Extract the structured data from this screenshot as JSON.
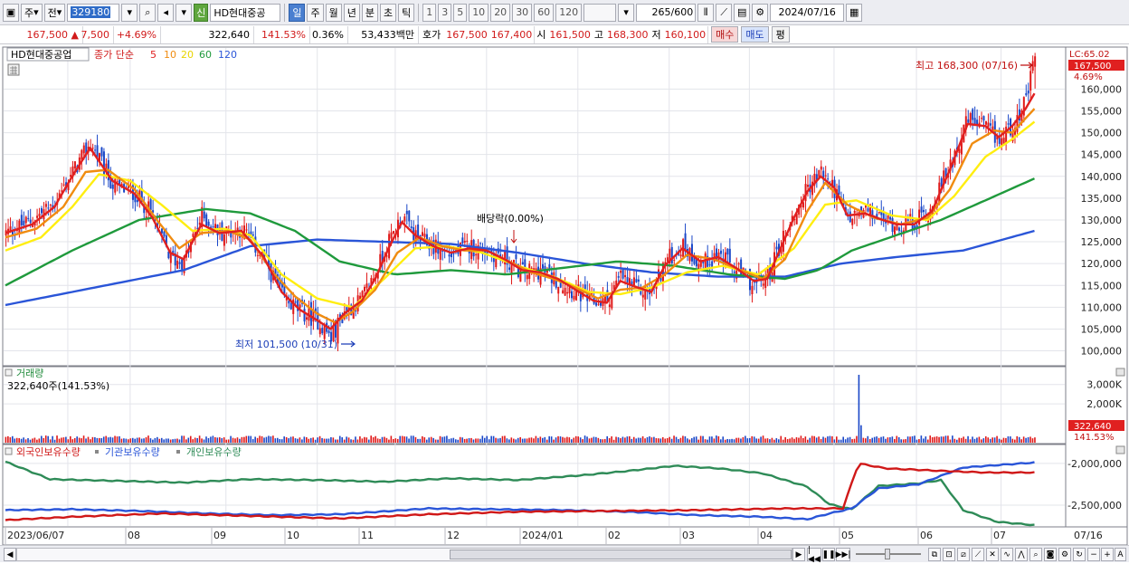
{
  "toolbar": {
    "mode_label": "주",
    "prev_label": "전",
    "code": "329180",
    "stock_name": "HD현대중공",
    "sin_badge": "신",
    "periods": [
      "일",
      "주",
      "월",
      "년",
      "분",
      "초",
      "틱"
    ],
    "active_period": "일",
    "intervals": [
      "1",
      "3",
      "5",
      "10",
      "20",
      "30",
      "60",
      "120"
    ],
    "count_value": "265",
    "count_total": "/600",
    "date": "2024/07/16"
  },
  "quote": {
    "price": "167,500",
    "change_arrow": "▲",
    "change": "7,500",
    "change_pct": "+4.69%",
    "volume": "322,640",
    "volume_ratio": "141.53%",
    "turnover": "0.36%",
    "amount": "53,433백만",
    "bid_label": "호가",
    "ask": "167,500",
    "bid": "167,400",
    "open_label": "시",
    "open": "161,500",
    "high_label": "고",
    "high": "168,300",
    "low_label": "저",
    "low": "160,100",
    "buy_label": "매수",
    "sell_label": "매도",
    "eval_label": "평"
  },
  "price_panel": {
    "stock_tag": "HD현대중공업",
    "ma_title": "종가 단순",
    "ma_periods": [
      "5",
      "10",
      "20",
      "60",
      "120"
    ],
    "ma_colors": [
      "#e02020",
      "#f08c10",
      "#ffee10",
      "#1f9a3c",
      "#2a55d8"
    ],
    "lc_label": "LC:65.02",
    "last_price_tag": "167,500",
    "last_pct_tag": "4.69%",
    "y_ticks": [
      "160,000",
      "155,000",
      "150,000",
      "145,000",
      "140,000",
      "135,000",
      "130,000",
      "125,000",
      "120,000",
      "115,000",
      "110,000",
      "105,000",
      "100,000"
    ],
    "high_annotation": "최고 168,300 (07/16)",
    "low_annotation": "최저 101,500 (10/31)",
    "dividend_annotation": "배당락(0.00%)"
  },
  "volume_panel": {
    "title": "거래량",
    "value_label": "322,640주(141.53%)",
    "y_ticks": [
      "3,000K",
      "2,000K"
    ],
    "last_tag": "322,640",
    "last_pct_tag": "141.53%"
  },
  "holdings_panel": {
    "series_labels": [
      "외국인보유수량",
      "기관보유수량",
      "개인보유수량"
    ],
    "series_colors": [
      "#d01818",
      "#2a55d8",
      "#2e8b57"
    ],
    "y_ticks": [
      "-2,000,000",
      "-2,500,000"
    ]
  },
  "x_axis": {
    "labels": [
      "2023/06/07",
      "08",
      "09",
      "10",
      "11",
      "12",
      "2024/01",
      "02",
      "03",
      "04",
      "05",
      "06",
      "07"
    ],
    "last_label": "07/16"
  },
  "chart_data": {
    "type": "candlestick",
    "price_range": [
      97000,
      169000
    ],
    "months": [
      "2023/06",
      "2023/07",
      "2023/08",
      "2023/09",
      "2023/10",
      "2023/11",
      "2023/12",
      "2024/01",
      "2024/02",
      "2024/03",
      "2024/04",
      "2024/05",
      "2024/06",
      "2024/07"
    ],
    "close_path": [
      [
        0,
        127000
      ],
      [
        12,
        130000
      ],
      [
        22,
        134000
      ],
      [
        30,
        141000
      ],
      [
        38,
        147500
      ],
      [
        48,
        138000
      ],
      [
        58,
        136000
      ],
      [
        66,
        131000
      ],
      [
        74,
        121000
      ],
      [
        80,
        120500
      ],
      [
        88,
        131000
      ],
      [
        96,
        127000
      ],
      [
        106,
        128000
      ],
      [
        116,
        121000
      ],
      [
        124,
        112500
      ],
      [
        132,
        109000
      ],
      [
        140,
        107000
      ],
      [
        146,
        103000
      ],
      [
        152,
        109000
      ],
      [
        160,
        112000
      ],
      [
        166,
        118000
      ],
      [
        172,
        125000
      ],
      [
        178,
        131000
      ],
      [
        184,
        126000
      ],
      [
        192,
        124000
      ],
      [
        200,
        122000
      ],
      [
        208,
        124000
      ],
      [
        216,
        123000
      ],
      [
        224,
        121000
      ],
      [
        232,
        118000
      ],
      [
        240,
        118500
      ],
      [
        248,
        116000
      ],
      [
        256,
        113500
      ],
      [
        264,
        111000
      ],
      [
        270,
        111500
      ],
      [
        276,
        117000
      ],
      [
        284,
        114000
      ],
      [
        290,
        113500
      ],
      [
        296,
        120500
      ],
      [
        304,
        124000
      ],
      [
        312,
        120000
      ],
      [
        320,
        122000
      ],
      [
        328,
        118500
      ],
      [
        336,
        115000
      ],
      [
        342,
        117000
      ],
      [
        348,
        125000
      ],
      [
        354,
        131000
      ],
      [
        360,
        137500
      ],
      [
        366,
        141000
      ],
      [
        372,
        137000
      ],
      [
        378,
        130000
      ],
      [
        386,
        132000
      ],
      [
        394,
        130000
      ],
      [
        400,
        129000
      ],
      [
        408,
        129500
      ],
      [
        416,
        133000
      ],
      [
        424,
        143000
      ],
      [
        432,
        153000
      ],
      [
        440,
        151000
      ],
      [
        446,
        148000
      ],
      [
        452,
        152000
      ],
      [
        458,
        157000
      ],
      [
        462,
        167500
      ]
    ],
    "ma5": [
      [
        0,
        127000
      ],
      [
        12,
        129000
      ],
      [
        22,
        133000
      ],
      [
        30,
        140000
      ],
      [
        38,
        146500
      ],
      [
        48,
        139000
      ],
      [
        58,
        136000
      ],
      [
        66,
        130500
      ],
      [
        74,
        122500
      ],
      [
        80,
        121000
      ],
      [
        88,
        129000
      ],
      [
        96,
        127000
      ],
      [
        106,
        127500
      ],
      [
        116,
        121500
      ],
      [
        124,
        113500
      ],
      [
        132,
        109500
      ],
      [
        140,
        107000
      ],
      [
        146,
        105000
      ],
      [
        152,
        108500
      ],
      [
        160,
        111500
      ],
      [
        166,
        116500
      ],
      [
        172,
        123500
      ],
      [
        178,
        129500
      ],
      [
        184,
        126500
      ],
      [
        192,
        124000
      ],
      [
        200,
        122500
      ],
      [
        208,
        123500
      ],
      [
        216,
        123000
      ],
      [
        224,
        121000
      ],
      [
        232,
        118500
      ],
      [
        240,
        118000
      ],
      [
        248,
        116500
      ],
      [
        256,
        114000
      ],
      [
        264,
        111500
      ],
      [
        270,
        111000
      ],
      [
        276,
        116000
      ],
      [
        284,
        114500
      ],
      [
        290,
        113500
      ],
      [
        296,
        119500
      ],
      [
        304,
        123500
      ],
      [
        312,
        120500
      ],
      [
        320,
        121500
      ],
      [
        328,
        119000
      ],
      [
        336,
        116000
      ],
      [
        342,
        116500
      ],
      [
        348,
        123500
      ],
      [
        354,
        130500
      ],
      [
        360,
        136500
      ],
      [
        366,
        140000
      ],
      [
        372,
        137500
      ],
      [
        378,
        131000
      ],
      [
        386,
        131500
      ],
      [
        394,
        130000
      ],
      [
        400,
        129000
      ],
      [
        408,
        129000
      ],
      [
        416,
        132000
      ],
      [
        424,
        141500
      ],
      [
        432,
        152000
      ],
      [
        440,
        151500
      ],
      [
        446,
        149000
      ],
      [
        452,
        151500
      ],
      [
        458,
        155500
      ],
      [
        462,
        159000
      ]
    ],
    "ma10": [
      [
        0,
        126000
      ],
      [
        14,
        128000
      ],
      [
        26,
        133000
      ],
      [
        36,
        141000
      ],
      [
        46,
        141500
      ],
      [
        58,
        137000
      ],
      [
        68,
        130000
      ],
      [
        78,
        123500
      ],
      [
        88,
        127000
      ],
      [
        100,
        127500
      ],
      [
        110,
        125500
      ],
      [
        120,
        118000
      ],
      [
        130,
        112500
      ],
      [
        140,
        108500
      ],
      [
        148,
        106500
      ],
      [
        156,
        109000
      ],
      [
        166,
        114000
      ],
      [
        176,
        122500
      ],
      [
        186,
        126000
      ],
      [
        196,
        124000
      ],
      [
        206,
        123000
      ],
      [
        216,
        123000
      ],
      [
        226,
        120500
      ],
      [
        236,
        118000
      ],
      [
        246,
        116500
      ],
      [
        256,
        114500
      ],
      [
        266,
        112000
      ],
      [
        276,
        114000
      ],
      [
        286,
        114500
      ],
      [
        296,
        117500
      ],
      [
        306,
        122000
      ],
      [
        318,
        121000
      ],
      [
        330,
        118500
      ],
      [
        340,
        116500
      ],
      [
        350,
        121000
      ],
      [
        360,
        132000
      ],
      [
        368,
        138500
      ],
      [
        378,
        133500
      ],
      [
        390,
        130500
      ],
      [
        402,
        129000
      ],
      [
        414,
        130500
      ],
      [
        424,
        137000
      ],
      [
        434,
        147500
      ],
      [
        444,
        150500
      ],
      [
        452,
        150000
      ],
      [
        462,
        155500
      ]
    ],
    "ma20": [
      [
        0,
        123000
      ],
      [
        16,
        126000
      ],
      [
        30,
        133000
      ],
      [
        42,
        140500
      ],
      [
        56,
        139000
      ],
      [
        70,
        133500
      ],
      [
        84,
        127500
      ],
      [
        98,
        128000
      ],
      [
        110,
        126500
      ],
      [
        124,
        117500
      ],
      [
        140,
        112000
      ],
      [
        156,
        110000
      ],
      [
        170,
        116500
      ],
      [
        184,
        123500
      ],
      [
        198,
        124000
      ],
      [
        214,
        122500
      ],
      [
        230,
        119500
      ],
      [
        246,
        117000
      ],
      [
        262,
        113500
      ],
      [
        276,
        113000
      ],
      [
        290,
        114500
      ],
      [
        306,
        118000
      ],
      [
        322,
        119500
      ],
      [
        338,
        117500
      ],
      [
        354,
        123500
      ],
      [
        368,
        133500
      ],
      [
        382,
        134500
      ],
      [
        398,
        131000
      ],
      [
        414,
        130000
      ],
      [
        426,
        135500
      ],
      [
        440,
        144500
      ],
      [
        452,
        148500
      ],
      [
        462,
        152500
      ]
    ],
    "ma60": [
      [
        0,
        115000
      ],
      [
        30,
        123000
      ],
      [
        60,
        130000
      ],
      [
        90,
        132500
      ],
      [
        110,
        131500
      ],
      [
        130,
        127500
      ],
      [
        150,
        120500
      ],
      [
        175,
        117500
      ],
      [
        200,
        118500
      ],
      [
        225,
        117500
      ],
      [
        250,
        119000
      ],
      [
        275,
        120500
      ],
      [
        300,
        119500
      ],
      [
        325,
        117500
      ],
      [
        350,
        116500
      ],
      [
        365,
        118500
      ],
      [
        380,
        123000
      ],
      [
        400,
        126500
      ],
      [
        420,
        130000
      ],
      [
        440,
        134500
      ],
      [
        462,
        139500
      ]
    ],
    "ma120": [
      [
        0,
        110500
      ],
      [
        40,
        114500
      ],
      [
        80,
        118500
      ],
      [
        110,
        124000
      ],
      [
        140,
        125500
      ],
      [
        170,
        125000
      ],
      [
        200,
        124500
      ],
      [
        230,
        122500
      ],
      [
        260,
        120000
      ],
      [
        290,
        118000
      ],
      [
        320,
        117000
      ],
      [
        350,
        117000
      ],
      [
        375,
        120000
      ],
      [
        400,
        121500
      ],
      [
        430,
        123000
      ],
      [
        462,
        127500
      ]
    ],
    "high": {
      "date": "07/16",
      "value": 168300
    },
    "low": {
      "date": "10/31",
      "value": 101500
    },
    "volume_range": [
      0,
      3500000
    ],
    "volume_spike": {
      "day": 383,
      "value": 3500000
    },
    "holdings_range": [
      -2750000,
      -1850000
    ],
    "foreign_holdings": [
      [
        0,
        -2680000
      ],
      [
        30,
        -2640000
      ],
      [
        70,
        -2600000
      ],
      [
        110,
        -2630000
      ],
      [
        150,
        -2660000
      ],
      [
        190,
        -2610000
      ],
      [
        230,
        -2580000
      ],
      [
        270,
        -2570000
      ],
      [
        310,
        -2560000
      ],
      [
        350,
        -2540000
      ],
      [
        376,
        -2540000
      ],
      [
        383,
        -2000000
      ],
      [
        395,
        -2060000
      ],
      [
        420,
        -2090000
      ],
      [
        440,
        -2110000
      ],
      [
        462,
        -2110000
      ]
    ],
    "institution_holdings": [
      [
        0,
        -2560000
      ],
      [
        30,
        -2550000
      ],
      [
        60,
        -2570000
      ],
      [
        90,
        -2600000
      ],
      [
        120,
        -2620000
      ],
      [
        150,
        -2610000
      ],
      [
        190,
        -2540000
      ],
      [
        220,
        -2550000
      ],
      [
        250,
        -2560000
      ],
      [
        280,
        -2580000
      ],
      [
        310,
        -2620000
      ],
      [
        340,
        -2640000
      ],
      [
        360,
        -2670000
      ],
      [
        370,
        -2600000
      ],
      [
        380,
        -2540000
      ],
      [
        392,
        -2300000
      ],
      [
        410,
        -2250000
      ],
      [
        430,
        -2050000
      ],
      [
        462,
        -1990000
      ]
    ],
    "individual_holdings": [
      [
        0,
        -1980000
      ],
      [
        20,
        -2190000
      ],
      [
        50,
        -2210000
      ],
      [
        80,
        -2230000
      ],
      [
        110,
        -2190000
      ],
      [
        140,
        -2200000
      ],
      [
        170,
        -2220000
      ],
      [
        200,
        -2180000
      ],
      [
        230,
        -2200000
      ],
      [
        260,
        -2140000
      ],
      [
        280,
        -2090000
      ],
      [
        300,
        -2030000
      ],
      [
        320,
        -2060000
      ],
      [
        340,
        -2120000
      ],
      [
        360,
        -2280000
      ],
      [
        370,
        -2490000
      ],
      [
        380,
        -2550000
      ],
      [
        392,
        -2270000
      ],
      [
        410,
        -2240000
      ],
      [
        420,
        -2200000
      ],
      [
        430,
        -2560000
      ],
      [
        445,
        -2700000
      ],
      [
        462,
        -2740000
      ]
    ]
  }
}
